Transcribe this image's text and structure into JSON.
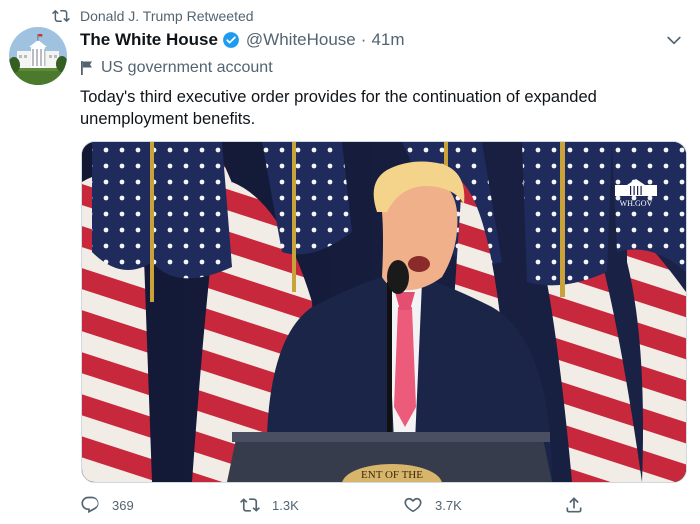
{
  "retweet": {
    "label": "Donald J. Trump Retweeted",
    "icon": "retweet-icon"
  },
  "author": {
    "name": "The White House",
    "handle": "@WhiteHouse",
    "separator": "·",
    "time": "41m",
    "verified_icon": "verified-badge-icon",
    "avatar_icon": "white-house-avatar"
  },
  "account_label": {
    "text": "US government account",
    "icon": "government-flag-icon"
  },
  "tweet": {
    "text_line1": "Today's third executive order provides for the continuation of expanded",
    "text_line2": "unemployment benefits."
  },
  "media": {
    "type": "video-still",
    "subject": "speaker-at-podium-with-flags",
    "watermark_text": "WH.GOV",
    "seal_text": "ENT OF THE"
  },
  "actions": {
    "reply_count": "369",
    "retweet_count": "1.3K",
    "like_count": "3.7K",
    "share_icon": "share-icon"
  },
  "colors": {
    "text_primary": "#0f1419",
    "text_secondary": "#536471",
    "verified_blue": "#1d9bf0",
    "border": "#cfd9de"
  }
}
